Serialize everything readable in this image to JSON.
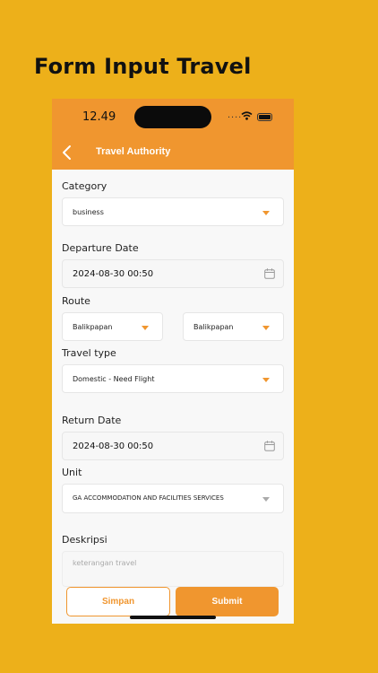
{
  "headline": "Form Input Travel",
  "status_bar": {
    "time": "12.49",
    "signal": "...."
  },
  "navbar": {
    "title": "Travel Authority"
  },
  "form": {
    "category": {
      "label": "Category",
      "value": "business"
    },
    "departure_date": {
      "label": "Departure Date",
      "value": "2024-08-30 00:50"
    },
    "route": {
      "label": "Route",
      "from": "Balikpapan",
      "to": "Balikpapan"
    },
    "travel_type": {
      "label": "Travel type",
      "value": "Domestic - Need Flight"
    },
    "return_date": {
      "label": "Return Date",
      "value": "2024-08-30 00:50"
    },
    "unit": {
      "label": "Unit",
      "value": "GA ACCOMMODATION AND FACILITIES SERVICES"
    },
    "deskripsi": {
      "label": "Deskripsi",
      "placeholder": "keterangan travel"
    }
  },
  "buttons": {
    "simpan": "Simpan",
    "submit": "Submit"
  },
  "colors": {
    "background": "#EDB01A",
    "accent": "#F0962F",
    "screen": "#F8F8F8"
  }
}
